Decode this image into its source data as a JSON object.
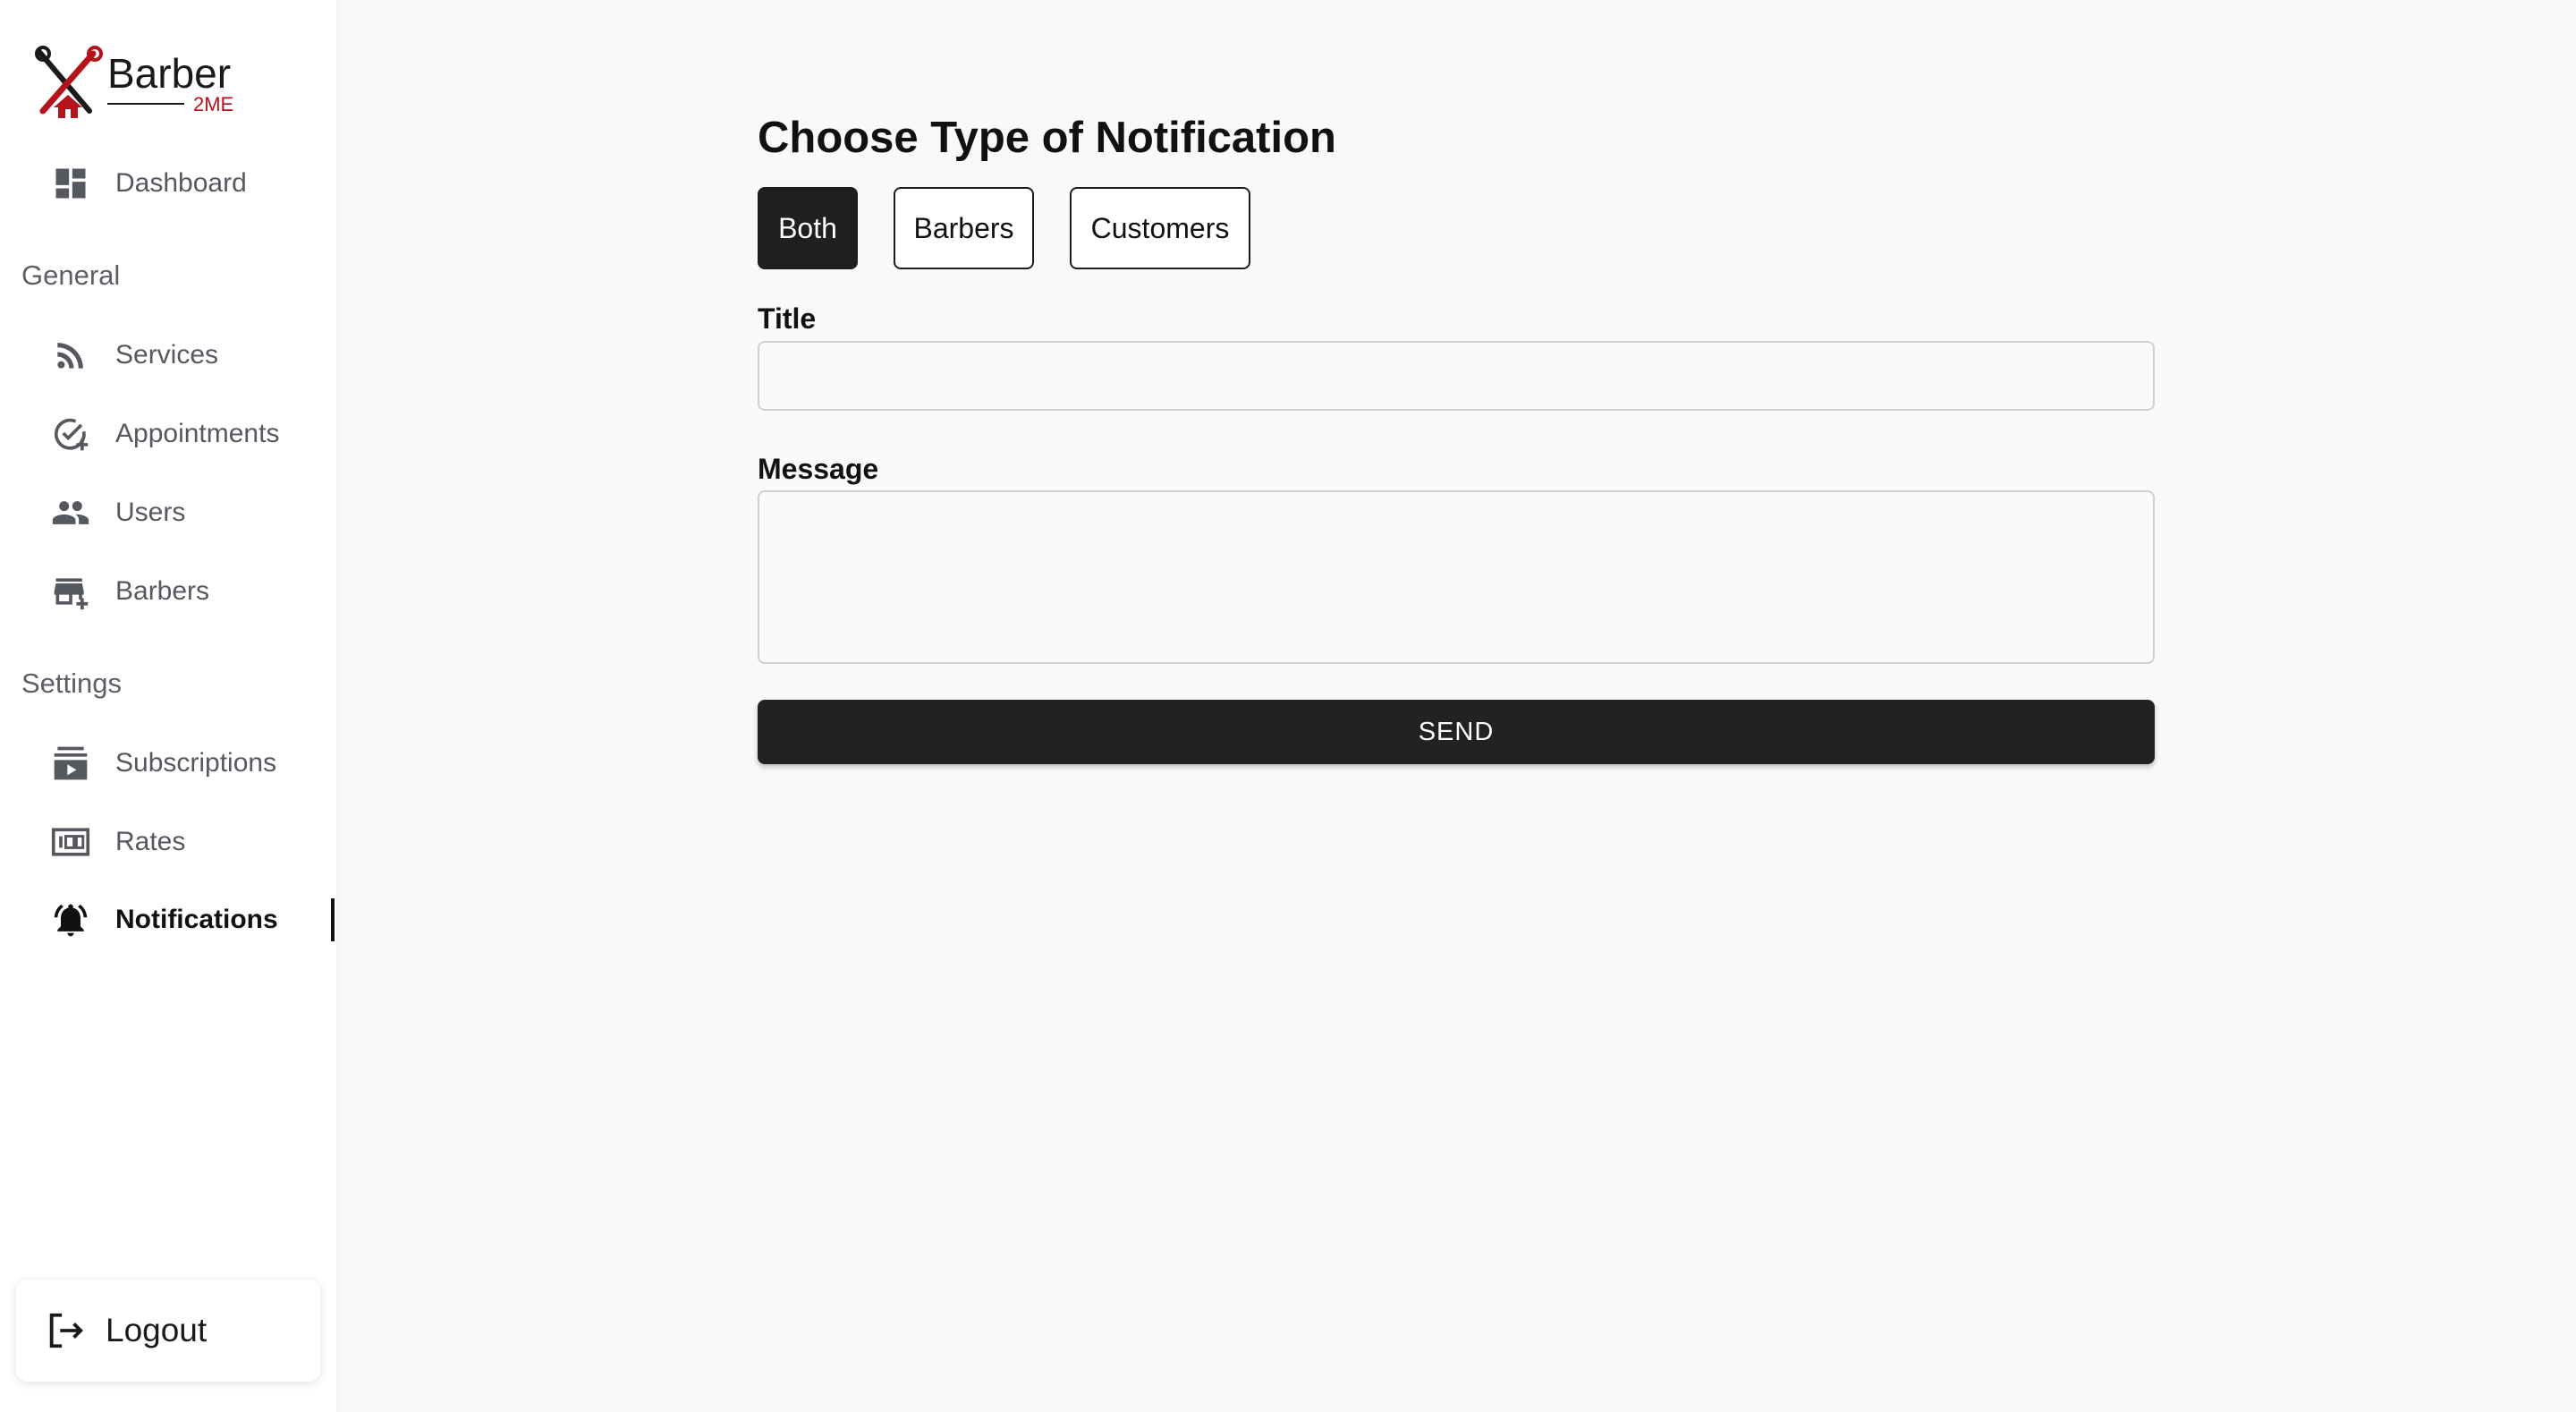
{
  "brand": {
    "name": "Barber",
    "sub": "2ME",
    "accent_color": "#b5121b"
  },
  "sidebar": {
    "dashboard": {
      "label": "Dashboard",
      "icon": "dashboard-icon"
    },
    "sections": [
      {
        "title": "General",
        "items": [
          {
            "label": "Services",
            "icon": "rss-icon"
          },
          {
            "label": "Appointments",
            "icon": "calendar-check-add-icon"
          },
          {
            "label": "Users",
            "icon": "people-icon"
          },
          {
            "label": "Barbers",
            "icon": "store-add-icon"
          }
        ]
      },
      {
        "title": "Settings",
        "items": [
          {
            "label": "Subscriptions",
            "icon": "subscriptions-icon"
          },
          {
            "label": "Rates",
            "icon": "rates-100-icon"
          },
          {
            "label": "Notifications",
            "icon": "bell-ringing-icon",
            "active": true
          }
        ]
      }
    ],
    "logout_label": "Logout"
  },
  "main": {
    "title": "Choose Type of Notification",
    "types": [
      {
        "label": "Both",
        "selected": true
      },
      {
        "label": "Barbers",
        "selected": false
      },
      {
        "label": "Customers",
        "selected": false
      }
    ],
    "title_field": {
      "label": "Title",
      "value": "",
      "placeholder": ""
    },
    "message_field": {
      "label": "Message",
      "value": "",
      "placeholder": ""
    },
    "send_label": "SEND"
  }
}
